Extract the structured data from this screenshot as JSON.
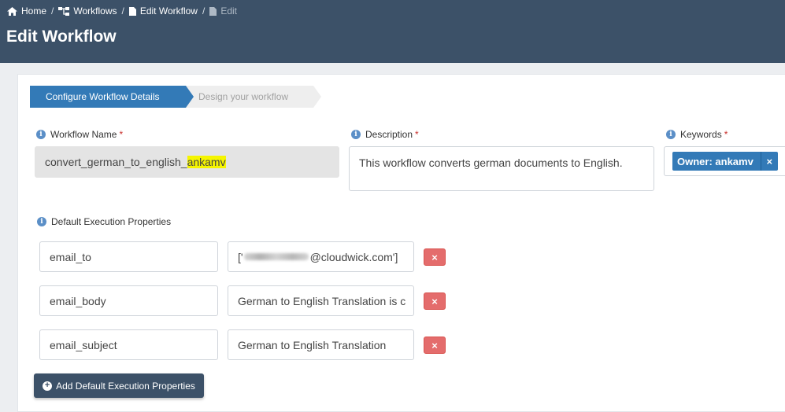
{
  "breadcrumb": {
    "home": "Home",
    "workflows": "Workflows",
    "edit_workflow": "Edit Workflow",
    "edit": "Edit",
    "separator": "/"
  },
  "page_title": "Edit Workflow",
  "steps": [
    {
      "label": "Configure Workflow Details",
      "active": true
    },
    {
      "label": "Design your workflow",
      "active": false
    }
  ],
  "fields": {
    "workflow_name": {
      "label": "Workflow Name",
      "required_mark": "*",
      "value_prefix": "convert_german_to_english_",
      "value_highlight": "ankamv"
    },
    "description": {
      "label": "Description",
      "required_mark": "*",
      "value": "This workflow converts german documents to English."
    },
    "keywords": {
      "label": "Keywords",
      "required_mark": "*",
      "tags": [
        {
          "label": "Owner: ankamv",
          "remove": "×"
        }
      ]
    }
  },
  "execution_properties": {
    "label": "Default Execution Properties",
    "rows": [
      {
        "key": "email_to",
        "value_prefix": "['",
        "value_suffix": "@cloudwick.com']",
        "value_redacted": true
      },
      {
        "key": "email_body",
        "value": "German to English Translation is c"
      },
      {
        "key": "email_subject",
        "value": "German to English Translation"
      }
    ],
    "delete_label": "×",
    "add_button": "Add Default Execution Properties"
  },
  "colors": {
    "header": "#3c5168",
    "primary": "#337ab7",
    "danger": "#e46c6c",
    "required": "#c9302c",
    "highlight": "#f5f500"
  },
  "icons": {
    "home": "home-icon",
    "workflows": "sitemap-icon",
    "edit_workflow": "file-icon",
    "edit": "file-icon",
    "info": "info-circle-icon",
    "add": "plus-circle-icon",
    "remove": "times-icon"
  }
}
